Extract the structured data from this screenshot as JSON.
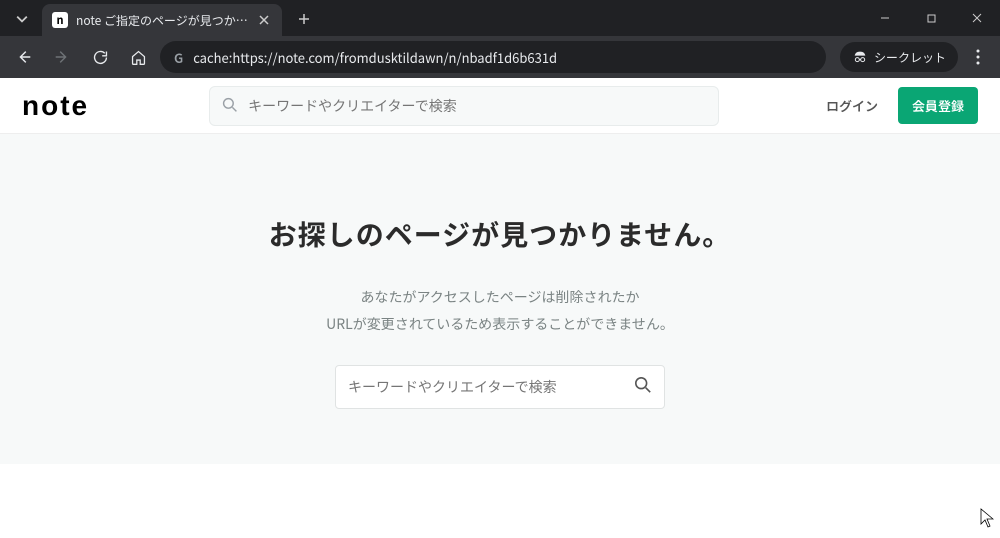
{
  "browser": {
    "tab": {
      "favicon_letter": "n",
      "title": "note ご指定のページが見つかりませ"
    },
    "url": "cache:https://note.com/fromdusktildawn/n/nbadf1d6b631d",
    "incognito_label": "シークレット"
  },
  "site": {
    "logo_text": "note",
    "header_search_placeholder": "キーワードやクリエイターで検索",
    "login_label": "ログイン",
    "signup_label": "会員登録"
  },
  "notfound": {
    "title": "お探しのページが見つかりません。",
    "desc_line1": "あなたがアクセスしたページは削除されたか",
    "desc_line2": "URLが変更されているため表示することができません。",
    "search_placeholder": "キーワードやクリエイターで検索"
  }
}
